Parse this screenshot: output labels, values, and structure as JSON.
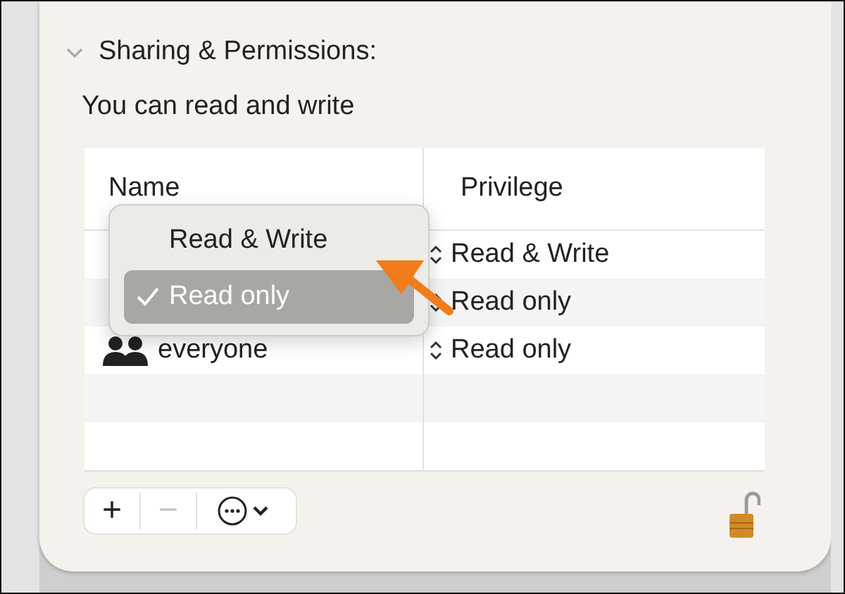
{
  "section": {
    "title": "Sharing & Permissions:",
    "expanded": true
  },
  "status": "You can read and write",
  "table": {
    "columns": [
      "Name",
      "Privilege"
    ],
    "rows": [
      {
        "privilege": "Read & Write"
      },
      {
        "privilege": "Read only"
      },
      {
        "name": "everyone",
        "privilege": "Read only"
      }
    ]
  },
  "popup": {
    "items": [
      {
        "label": "Read & Write",
        "selected": false
      },
      {
        "label": "Read only",
        "selected": true
      }
    ]
  },
  "toolbar": {
    "buttons": [
      {
        "label": "+",
        "disabled": false
      },
      {
        "label": "−",
        "disabled": true
      }
    ]
  },
  "lock": {
    "locked": false
  }
}
